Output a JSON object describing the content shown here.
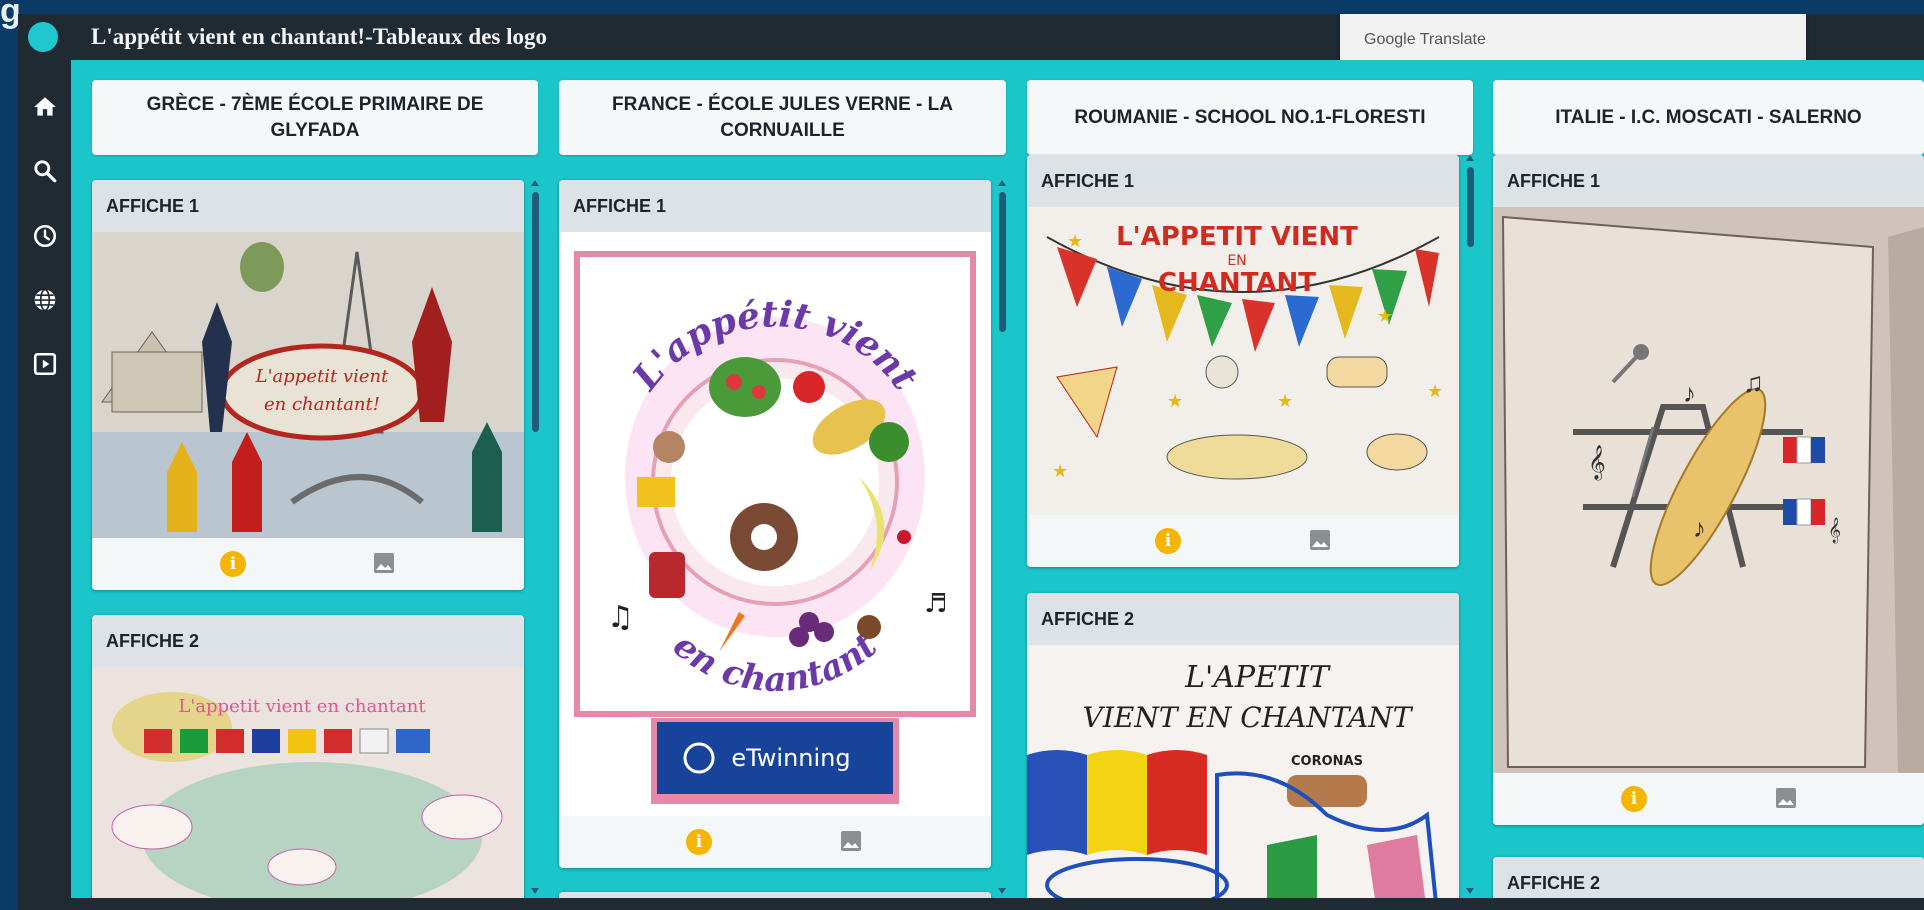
{
  "app": {
    "title": "L'appétit vient en chantant!-Tableaux des logo",
    "corner_text": "g"
  },
  "translate": {
    "label": "Google Translate"
  },
  "sidebar": {
    "items": [
      {
        "name": "home-icon"
      },
      {
        "name": "search-icon"
      },
      {
        "name": "clock-icon"
      },
      {
        "name": "globe-icon"
      },
      {
        "name": "slideshow-icon"
      }
    ]
  },
  "columns": [
    {
      "header": "GRÈCE - 7ÈME ÉCOLE PRIMAIRE DE GLYFADA",
      "cards": [
        {
          "title": "AFFICHE 1",
          "art": {
            "text_1": "L'appetit vient",
            "text_2": "en chantant!"
          }
        },
        {
          "title": "AFFICHE 2",
          "art": {
            "text_1": "L'appetit vient en chantant"
          }
        }
      ]
    },
    {
      "header": "FRANCE - ÉCOLE JULES VERNE - LA CORNUAILLE",
      "cards": [
        {
          "title": "AFFICHE 1",
          "art": {
            "arc_top": "L'appétit vient",
            "arc_bottom": "en chantant",
            "badge": "eTwinning"
          }
        }
      ]
    },
    {
      "header": "ROUMANIE - SCHOOL NO.1-FLORESTI",
      "cards": [
        {
          "title": "AFFICHE 1",
          "art": {
            "line_1": "L'APPETIT VIENT",
            "line_2": "EN",
            "line_3": "CHANTANT"
          }
        },
        {
          "title": "AFFICHE 2",
          "art": {
            "line_1": "L'APETIT",
            "line_2": "VIENT EN CHANTANT",
            "label": "CORONAS"
          }
        }
      ]
    },
    {
      "header": "ITALIE - I.C. MOSCATI - SALERNO",
      "cards": [
        {
          "title": "AFFICHE 1"
        },
        {
          "title": "AFFICHE 2"
        }
      ]
    }
  ]
}
